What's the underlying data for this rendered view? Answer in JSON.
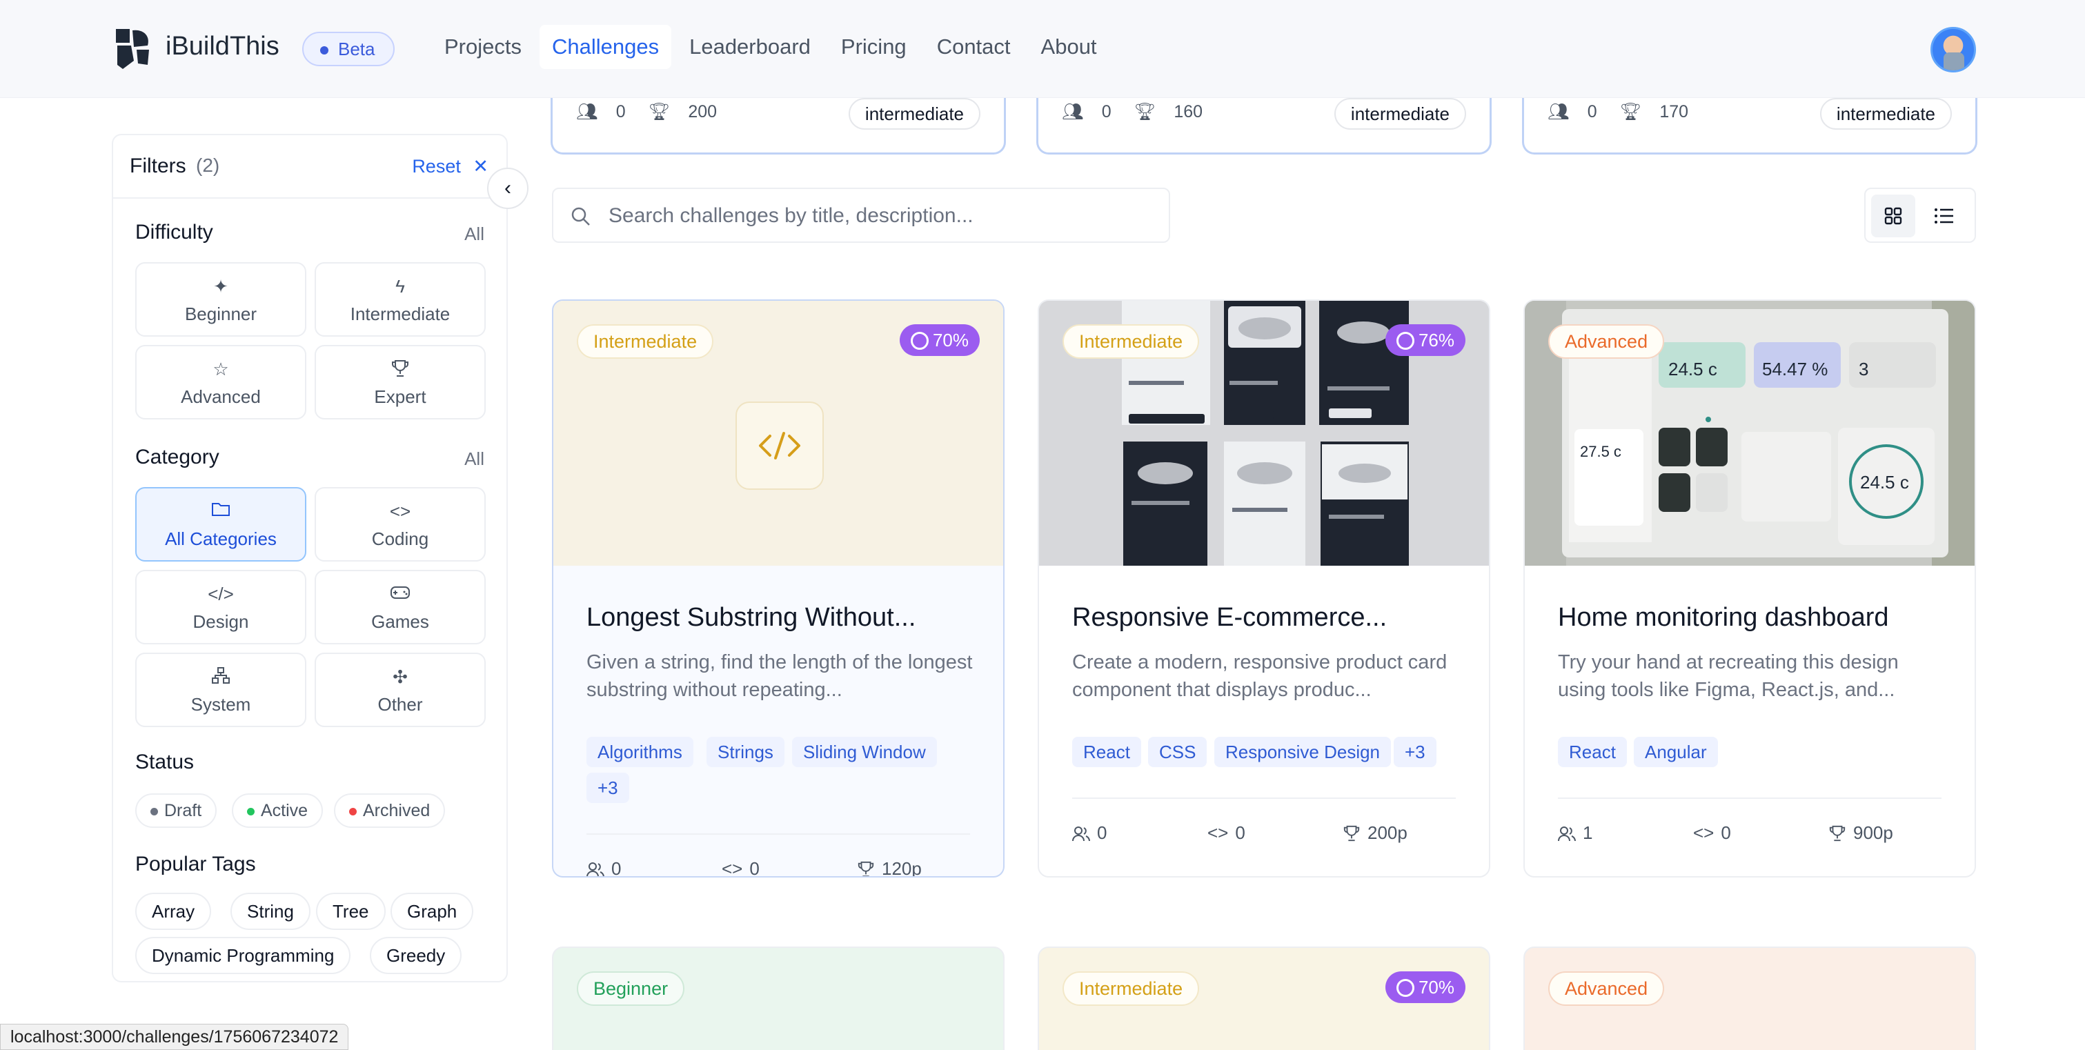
{
  "app": {
    "brand": "iBuildThis",
    "beta_label": "Beta"
  },
  "nav": {
    "items": [
      "Projects",
      "Challenges",
      "Leaderboard",
      "Pricing",
      "Contact",
      "About"
    ],
    "active": "Challenges"
  },
  "filters": {
    "title": "Filters",
    "count": "(2)",
    "reset_label": "Reset",
    "difficulty": {
      "title": "Difficulty",
      "all_label": "All",
      "options": [
        "Beginner",
        "Intermediate",
        "Advanced",
        "Expert"
      ]
    },
    "category": {
      "title": "Category",
      "all_label": "All",
      "options": [
        "All Categories",
        "Coding",
        "Design",
        "Games",
        "System",
        "Other"
      ],
      "selected": "All Categories"
    },
    "status": {
      "title": "Status",
      "options": [
        {
          "label": "Draft",
          "color": "#6b7280"
        },
        {
          "label": "Active",
          "color": "#22c55e"
        },
        {
          "label": "Archived",
          "color": "#ef4444"
        }
      ]
    },
    "popular_tags": {
      "title": "Popular Tags",
      "tags": [
        "Array",
        "String",
        "Tree",
        "Graph",
        "Dynamic Programming",
        "Greedy"
      ]
    }
  },
  "top_cards": [
    {
      "participants": "0",
      "points": "200",
      "level": "intermediate"
    },
    {
      "participants": "0",
      "points": "160",
      "level": "intermediate"
    },
    {
      "participants": "0",
      "points": "170",
      "level": "intermediate"
    }
  ],
  "search": {
    "placeholder": "Search challenges by title, description...",
    "value": ""
  },
  "cards": [
    {
      "level": "Intermediate",
      "level_color": "#d4a017",
      "percent": "70%",
      "title": "Longest Substring Without...",
      "description": "Given a string, find the length of the longest substring without repeating...",
      "tags": [
        "Algorithms",
        "Strings",
        "Sliding Window",
        "+3"
      ],
      "participants": "0",
      "submissions": "0",
      "points": "120p",
      "media_icon": "code-icon"
    },
    {
      "level": "Intermediate",
      "level_color": "#d4a017",
      "percent": "76%",
      "title": "Responsive E-commerce...",
      "description": "Create a modern, responsive product card component that displays produc...",
      "tags": [
        "React",
        "CSS",
        "Responsive Design",
        "+3"
      ],
      "participants": "0",
      "submissions": "0",
      "points": "200p"
    },
    {
      "level": "Advanced",
      "level_color": "#ea6a2a",
      "title": "Home monitoring dashboard",
      "description": "Try your hand at recreating this design using tools like Figma, React.js, and...",
      "tags": [
        "React",
        "Angular"
      ],
      "participants": "1",
      "submissions": "0",
      "points": "900p"
    }
  ],
  "bottom_cards": [
    {
      "level": "Beginner",
      "level_color": "#22a05a"
    },
    {
      "level": "Intermediate",
      "level_color": "#d4a017",
      "percent": "70%"
    },
    {
      "level": "Advanced",
      "level_color": "#ea6a2a"
    }
  ],
  "status_bar": {
    "url": "localhost:3000/challenges/1756067234072"
  }
}
